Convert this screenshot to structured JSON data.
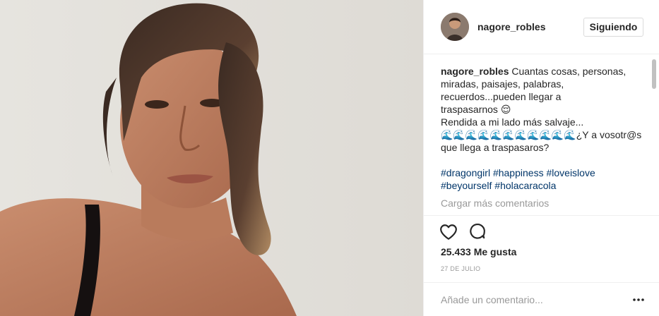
{
  "post": {
    "photo_description_icon": "selfie-photo",
    "author": {
      "username": "nagore_robles",
      "follow_label": "Siguiendo"
    },
    "caption": {
      "author": "nagore_robles",
      "lines": [
        "Cuantas cosas, personas,",
        "miradas, paisajes, palabras,",
        "recuerdos...pueden llegar a",
        "traspasarnos 😌",
        "Rendida a mi lado más salvaje...",
        "🌊🌊🌊🌊🌊🌊🌊🌊🌊🌊🌊¿Y a vosotr@s",
        "que llega a traspasaros?"
      ],
      "hashtags_line1": [
        "#dragongirl",
        "#happiness",
        "#loveislove"
      ],
      "hashtags_line2": [
        "#beyourself",
        "#holacaracola"
      ]
    },
    "load_more_label": "Cargar más comentarios",
    "likes_text": "25.433 Me gusta",
    "date_text": "27 DE JULIO",
    "comment_placeholder": "Añade un comentario...",
    "icons": {
      "like": "heart-icon",
      "comment": "comment-bubble-icon",
      "more": "more-options-icon"
    }
  }
}
